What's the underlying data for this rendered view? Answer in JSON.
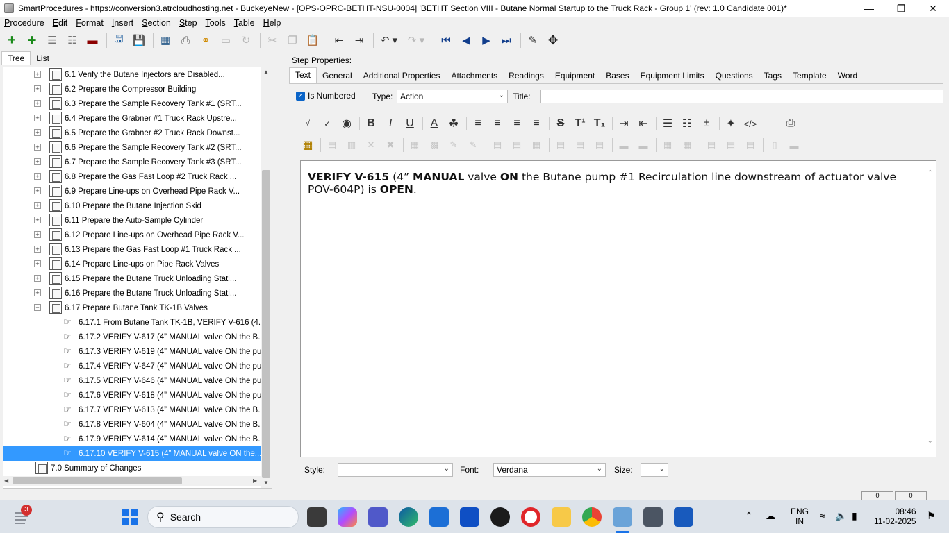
{
  "window": {
    "title": "SmartProcedures - https://conversion3.atrcloudhosting.net - BuckeyeNew - [OPS-OPRC-BETHT-NSU-0004] 'BETHT Section VIII - Butane Normal Startup to the Truck Rack - Group 1' (rev: 1.0 Candidate 001)*"
  },
  "menu": [
    "Procedure",
    "Edit",
    "Format",
    "Insert",
    "Section",
    "Step",
    "Tools",
    "Table",
    "Help"
  ],
  "left_tabs": [
    "Tree",
    "List"
  ],
  "tree": [
    {
      "label": "6.1 Verify the Butane Injectors are Disabled...",
      "level": 1
    },
    {
      "label": "6.2 Prepare the Compressor Building",
      "level": 1
    },
    {
      "label": "6.3 Prepare the Sample Recovery Tank #1 (SRT...",
      "level": 1
    },
    {
      "label": "6.4 Prepare the Grabner #1 Truck Rack Upstre...",
      "level": 1
    },
    {
      "label": "6.5 Prepare the Grabner #2 Truck Rack Downst...",
      "level": 1
    },
    {
      "label": "6.6 Prepare the Sample Recovery Tank #2 (SRT...",
      "level": 1
    },
    {
      "label": "6.7 Prepare the Sample Recovery Tank #3 (SRT...",
      "level": 1
    },
    {
      "label": "6.8 Prepare the Gas Fast Loop #2 Truck Rack ...",
      "level": 1
    },
    {
      "label": "6.9 Prepare Line-ups on Overhead Pipe Rack V...",
      "level": 1
    },
    {
      "label": "6.10 Prepare the Butane Injection Skid",
      "level": 1
    },
    {
      "label": "6.11 Prepare the Auto-Sample Cylinder",
      "level": 1
    },
    {
      "label": "6.12 Prepare Line-ups on Overhead Pipe Rack V...",
      "level": 1
    },
    {
      "label": "6.13 Prepare the Gas Fast Loop #1 Truck Rack ...",
      "level": 1
    },
    {
      "label": "6.14 Prepare Line-ups on Pipe Rack Valves",
      "level": 1
    },
    {
      "label": "6.15 Prepare the Butane Truck Unloading Stati...",
      "level": 1
    },
    {
      "label": "6.16 Prepare the Butane Truck Unloading Stati...",
      "level": 1
    },
    {
      "label": "6.17 Prepare Butane Tank TK-1B Valves",
      "level": 1,
      "expanded": true
    },
    {
      "label": "6.17.1 From Butane Tank TK-1B, VERIFY V-616 (4...",
      "level": 2
    },
    {
      "label": "6.17.2 VERIFY V-617 (4” MANUAL valve ON the B...",
      "level": 2
    },
    {
      "label": "6.17.3 VERIFY V-619 (4” MANUAL valve ON the pu...",
      "level": 2
    },
    {
      "label": "6.17.4 VERIFY V-647 (4” MANUAL valve ON the pu...",
      "level": 2
    },
    {
      "label": "6.17.5 VERIFY V-646 (4” MANUAL valve ON the pu...",
      "level": 2
    },
    {
      "label": "6.17.6 VERIFY V-618 (4” MANUAL valve ON the pu...",
      "level": 2
    },
    {
      "label": "6.17.7 VERIFY V-613 (4” MANUAL valve ON the B...",
      "level": 2
    },
    {
      "label": "6.17.8 VERIFY V-604 (4” MANUAL valve ON the B...",
      "level": 2
    },
    {
      "label": "6.17.9 VERIFY V-614 (4” MANUAL valve ON the B...",
      "level": 2
    },
    {
      "label": "6.17.10 VERIFY V-615 (4” MANUAL valve ON the...",
      "level": 2,
      "selected": true
    },
    {
      "label": "7.0 Summary of Changes",
      "level": 0
    }
  ],
  "step_properties": {
    "heading": "Step Properties:",
    "tabs": [
      "Text",
      "General",
      "Additional Properties",
      "Attachments",
      "Readings",
      "Equipment",
      "Bases",
      "Equipment Limits",
      "Questions",
      "Tags",
      "Template",
      "Word"
    ],
    "is_numbered_label": "Is Numbered",
    "type_label": "Type:",
    "type_value": "Action",
    "title_label": "Title:",
    "title_value": ""
  },
  "editor": {
    "segments": [
      {
        "text": "VERIFY V-615",
        "bold": true
      },
      {
        "text": " (4” ",
        "bold": false
      },
      {
        "text": "MANUAL",
        "bold": true
      },
      {
        "text": " valve ",
        "bold": false
      },
      {
        "text": "ON",
        "bold": true
      },
      {
        "text": " the Butane pump #1 Recirculation line downstream of actuator valve POV-604P) is ",
        "bold": false
      },
      {
        "text": "OPEN",
        "bold": true
      },
      {
        "text": ".",
        "bold": false
      }
    ]
  },
  "style_bar": {
    "style_label": "Style:",
    "style_value": "",
    "font_label": "Font:",
    "font_value": "Verdana",
    "size_label": "Size:",
    "size_value": ""
  },
  "status_strip": {
    "left_value": "0",
    "right_value": "0"
  },
  "taskbar": {
    "search_label": "Search",
    "notification_count": "3",
    "lang_line1": "ENG",
    "lang_line2": "IN",
    "time": "08:46",
    "date": "11-02-2025"
  },
  "colors": {
    "selection": "#3399ff",
    "checkbox": "#0a64c8",
    "windows_blue": "#1a73e8"
  }
}
